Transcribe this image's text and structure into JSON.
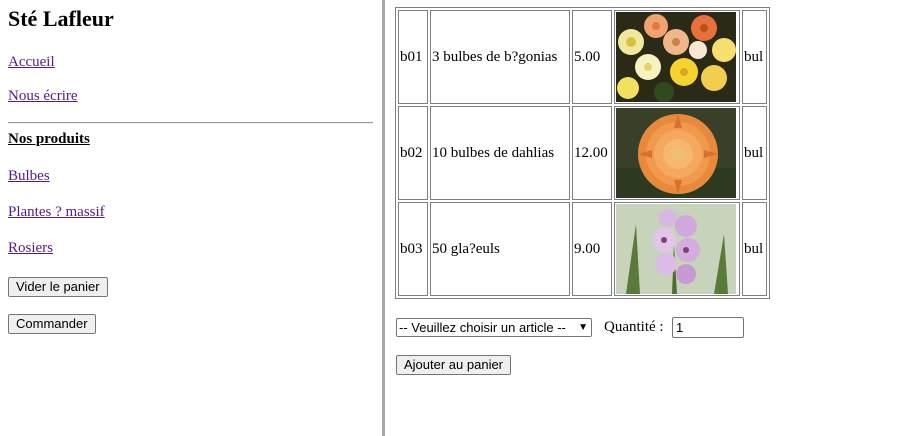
{
  "sidebar": {
    "brand": "Sté Lafleur",
    "links": {
      "home": "Accueil",
      "contact": "Nous écrire"
    },
    "section_title": "Nos produits",
    "categories": [
      "Bulbes",
      "Plantes ? massif",
      "Rosiers"
    ],
    "buttons": {
      "clear": "Vider le panier",
      "order": "Commander"
    }
  },
  "products": [
    {
      "code": "b01",
      "name": "3 bulbes de b?gonias",
      "price": "5.00",
      "category": "bul",
      "image": "begonia-flowers-icon"
    },
    {
      "code": "b02",
      "name": "10 bulbes de dahlias",
      "price": "12.00",
      "category": "bul",
      "image": "dahlia-flower-icon"
    },
    {
      "code": "b03",
      "name": "50 gla?euls",
      "price": "9.00",
      "category": "bul",
      "image": "gladiolus-flower-icon"
    }
  ],
  "order_form": {
    "select_value": "-- Veuillez choisir un article --",
    "quantity_label": "Quantité :",
    "quantity_value": "1",
    "add_button": "Ajouter au panier"
  },
  "colors": {
    "visited_link": "#551a8b",
    "divider": "#a9a9a9"
  }
}
